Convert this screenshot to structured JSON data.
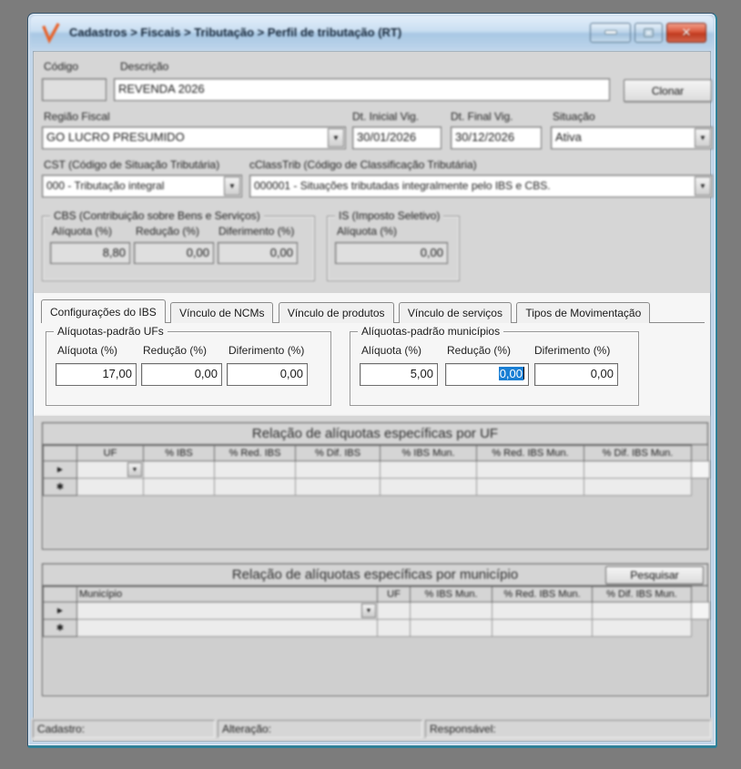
{
  "window": {
    "title": "Cadastros > Fiscais > Tributação > Perfil de tributação (RT)"
  },
  "icons": {
    "close": "✕",
    "dropdown": "▼",
    "current_record": "►",
    "new_record": "✱"
  },
  "colors": {
    "desktop_background": "#7c7c7c",
    "titlebar_blue": "#bcd4ea",
    "window_edge_teal": "#2f8199",
    "close_red": "#c03a1e",
    "selection_blue": "#1a7fd4",
    "highlight_band": "#f6f6f6",
    "dialog_gray": "#d6d6d6",
    "check_icon_orange": "#e8622a"
  },
  "header": {
    "codigo_label": "Código",
    "codigo_value": "",
    "descricao_label": "Descrição",
    "descricao_value": "REVENDA 2026",
    "clonar_button": "Clonar",
    "regiao_fiscal_label": "Região Fiscal",
    "regiao_fiscal_value": "GO LUCRO PRESUMIDO",
    "dt_inicial_label": "Dt. Inicial Vig.",
    "dt_inicial_value": "30/01/2026",
    "dt_final_label": "Dt. Final Vig.",
    "dt_final_value": "30/12/2026",
    "situacao_label": "Situação",
    "situacao_value": "Ativa",
    "cst_label": "CST (Código de Situação Tributária)",
    "cst_value": "000 - Tributação integral",
    "cclasstrib_label": "cClassTrib (Código de Classificação Tributária)",
    "cclasstrib_value": "000001 - Situações tributadas integralmente pelo IBS e CBS."
  },
  "cbs_group": {
    "title": "CBS (Contribuição sobre Bens e Serviços)",
    "aliquota_label": "Alíquota (%)",
    "aliquota_value": "8,80",
    "reducao_label": "Redução (%)",
    "reducao_value": "0,00",
    "diferimento_label": "Diferimento (%)",
    "diferimento_value": "0,00"
  },
  "is_group": {
    "title": "IS (Imposto Seletivo)",
    "aliquota_label": "Alíquota (%)",
    "aliquota_value": "0,00"
  },
  "tabs": {
    "items": [
      {
        "label": "Configurações do IBS"
      },
      {
        "label": "Vínculo de NCMs"
      },
      {
        "label": "Vínculo de produtos"
      },
      {
        "label": "Vínculo de serviços"
      },
      {
        "label": "Tipos de Movimentação"
      }
    ]
  },
  "ibs_uf_group": {
    "title": "Alíquotas-padrão UFs",
    "aliquota_label": "Alíquota (%)",
    "aliquota_value": "17,00",
    "reducao_label": "Redução (%)",
    "reducao_value": "0,00",
    "diferimento_label": "Diferimento (%)",
    "diferimento_value": "0,00"
  },
  "ibs_mun_group": {
    "title": "Alíquotas-padrão municípios",
    "aliquota_label": "Alíquota (%)",
    "aliquota_value": "5,00",
    "reducao_label": "Redução (%)",
    "reducao_value_selected": "0,00",
    "diferimento_label": "Diferimento (%)",
    "diferimento_value": "0,00"
  },
  "grid_uf": {
    "title": "Relação de alíquotas específicas por UF",
    "columns": [
      "UF",
      "% IBS",
      "% Red. IBS",
      "% Dif. IBS",
      "% IBS Mun.",
      "% Red. IBS Mun.",
      "% Dif. IBS Mun."
    ]
  },
  "grid_mun": {
    "title": "Relação de alíquotas específicas por município",
    "pesquisar_button": "Pesquisar",
    "columns": [
      "Município",
      "UF",
      "% IBS Mun.",
      "% Red. IBS Mun.",
      "% Dif. IBS Mun."
    ]
  },
  "statusbar": {
    "cadastro_label": "Cadastro:",
    "alteracao_label": "Alteração:",
    "responsavel_label": "Responsável:"
  }
}
